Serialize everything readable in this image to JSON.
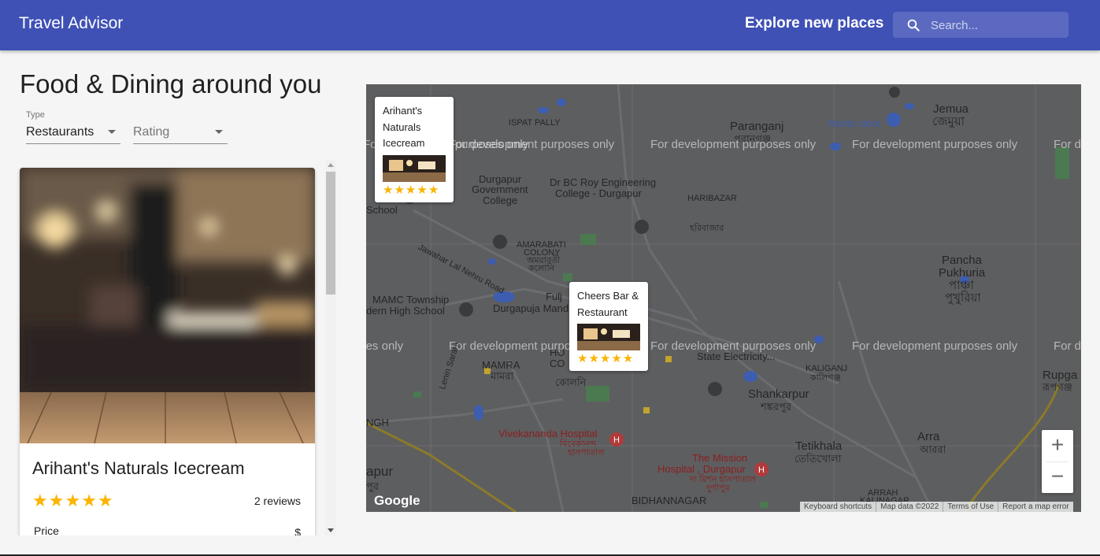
{
  "header": {
    "title": "Travel Advisor",
    "explore_text": "Explore new places",
    "search_placeholder": "Search..."
  },
  "list": {
    "heading": "Food & Dining around you",
    "type_filter": {
      "label": "Type",
      "value": "Restaurants"
    },
    "rating_filter": {
      "placeholder": "Rating"
    },
    "cards": [
      {
        "name": "Arihant's Naturals Icecream",
        "rating": 5,
        "reviews": "2 reviews",
        "price_label": "Price",
        "price_value": "$"
      }
    ]
  },
  "map": {
    "dev_notice": "For development purposes only",
    "labels": [
      "ISPAT PALLY",
      "Paranganj",
      "পরানগঞ্জ",
      "Rontu store",
      "Jemua",
      "জেমুয়া",
      "Durgapur",
      "Government",
      "College",
      "Dr BC Roy Engineering",
      "College - Durgapur",
      "HARIBAZAR",
      "হরিবাজার",
      "School",
      "AMARABATI",
      "COLONY",
      "অমরাবতী",
      "কলোনি",
      "Pancha",
      "Pukhuria",
      "পাঞ্চা",
      "পুখুরিয়া",
      "MAMC Township",
      "dern High School",
      "Durgapuja Mand",
      "Fulj",
      "MAMRA",
      "মামরা",
      "State Electricity...",
      "KALIGANJ",
      "কালিগঞ্জ",
      "Shankarpur",
      "শঙ্করপুর",
      "Rupga",
      "রূপগঞ্জ",
      "NGH",
      "Vivekananda Hospital",
      "বিবেকানন্দ",
      "হাসপাতাল",
      "The Mission",
      "Hospital , Durgapur",
      "দ্য মিশন হাসপাতাল",
      "দুর্গাপুর",
      "Tetikhala",
      "তেতিখোলা",
      "Arra",
      "আররা",
      "apur",
      "পুর",
      "BIDHANNAGAR",
      "ARRAH",
      "KALINAGAR",
      "Jawahar Lal Nehru Road",
      "Lenin Sarani",
      "HO",
      "CO",
      "কোলনি"
    ],
    "markers": [
      {
        "name_lines": [
          "Arihant's",
          "Naturals",
          "Icecream"
        ],
        "rating": 5
      },
      {
        "name_lines": [
          "Cheers Bar &",
          "Restaurant"
        ],
        "rating": 5
      }
    ],
    "zoom_in": "+",
    "zoom_out": "−",
    "logo": "Google",
    "attribution": [
      "Keyboard shortcuts",
      "Map data ©2022",
      "Terms of Use",
      "Report a map error"
    ]
  },
  "icons": {
    "search": "search-icon",
    "star": "star-icon",
    "dropdown": "dropdown-arrow-icon",
    "hospital": "hospital-icon",
    "school": "school-icon"
  },
  "colors": {
    "appbar": "#3f51b5",
    "star": "#fbb400",
    "map_bg": "#5d5e60"
  }
}
